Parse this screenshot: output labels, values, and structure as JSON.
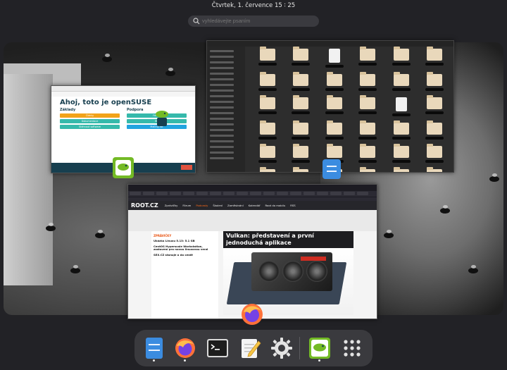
{
  "topbar": {
    "datetime": "Čtvrtek, 1. července  15 ∶ 25"
  },
  "search": {
    "placeholder": "vyhledávejte psaním"
  },
  "welcome_window": {
    "title": "Ahoj, toto je openSUSE",
    "col_left_heading": "Základy",
    "col_right_heading": "Podpora",
    "left_buttons": [
      "Články",
      "Dokumentace",
      "Stáhnout software"
    ],
    "right_buttons": [
      "Fórum",
      "IRC",
      "Mailing list"
    ]
  },
  "browser": {
    "logo": "ROOT.CZ",
    "nav": [
      "Zprávičky",
      "Fórum",
      "Podcasty",
      "Školení",
      "Zaměstnání",
      "Kalendář",
      "Root do mobilu",
      "RSS"
    ],
    "left_category": "ZPRÁVIČKY",
    "left_headlines": [
      "Ukázka Linuxu 5.13: 5.1 GB",
      "CentOS Hyperscale Workstation, zastavení pro novou linuxovou verzi",
      "SEX.CZ stanuje o do cestě"
    ],
    "main_title": "Vulkan: představení a první jednoduchá aplikace",
    "sub_label": "Reklama"
  },
  "dock": {
    "items": [
      {
        "name": "files",
        "label": "Soubory",
        "running": true
      },
      {
        "name": "firefox",
        "label": "Firefox",
        "running": true
      },
      {
        "name": "terminal",
        "label": "Terminál",
        "running": false
      },
      {
        "name": "text-editor",
        "label": "Textový editor",
        "running": false
      },
      {
        "name": "settings",
        "label": "Nastavení",
        "running": false
      },
      {
        "name": "opensuse-welcome",
        "label": "openSUSE Welcome",
        "running": true
      },
      {
        "name": "app-grid",
        "label": "Zobrazit aplikace",
        "running": false
      }
    ]
  },
  "colors": {
    "accent_orange": "#e8520f",
    "opensuse_green": "#73ba25",
    "dock_bg": "#3a3a3e"
  }
}
